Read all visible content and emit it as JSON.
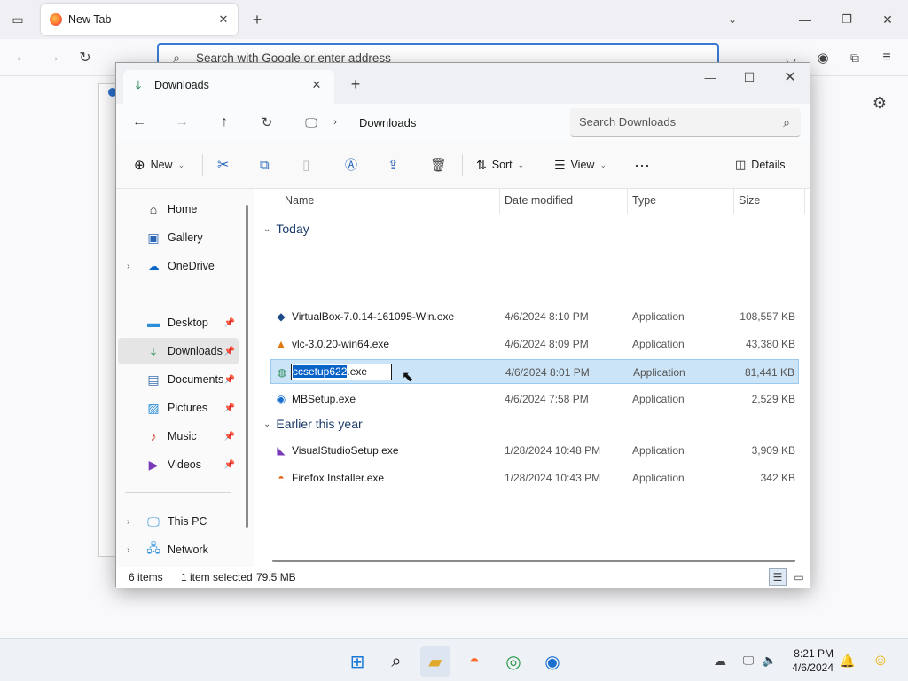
{
  "browser": {
    "tab_title": "New Tab",
    "url_placeholder": "Search with Google or enter address"
  },
  "explorer": {
    "tab_title": "Downloads",
    "breadcrumb": "Downloads",
    "search_placeholder": "Search Downloads",
    "commands": {
      "new": "New",
      "sort": "Sort",
      "view": "View",
      "details": "Details"
    },
    "nav": {
      "home": "Home",
      "gallery": "Gallery",
      "onedrive": "OneDrive",
      "desktop": "Desktop",
      "downloads": "Downloads",
      "documents": "Documents",
      "pictures": "Pictures",
      "music": "Music",
      "videos": "Videos",
      "thispc": "This PC",
      "network": "Network"
    },
    "columns": {
      "name": "Name",
      "date": "Date modified",
      "type": "Type",
      "size": "Size"
    },
    "groups": {
      "today": "Today",
      "earlier": "Earlier this year"
    },
    "files": [
      {
        "name": "VirtualBox-7.0.14-161095-Win.exe",
        "date": "4/6/2024 8:10 PM",
        "type": "Application",
        "size": "108,557 KB"
      },
      {
        "name": "vlc-3.0.20-win64.exe",
        "date": "4/6/2024 8:09 PM",
        "type": "Application",
        "size": "43,380 KB"
      },
      {
        "name": "ccsetup622.exe",
        "date": "4/6/2024 8:01 PM",
        "type": "Application",
        "size": "81,441 KB"
      },
      {
        "name": "MBSetup.exe",
        "date": "4/6/2024 7:58 PM",
        "type": "Application",
        "size": "2,529 KB"
      },
      {
        "name": "VisualStudioSetup.exe",
        "date": "1/28/2024 10:48 PM",
        "type": "Application",
        "size": "3,909 KB"
      },
      {
        "name": "Firefox Installer.exe",
        "date": "1/28/2024 10:43 PM",
        "type": "Application",
        "size": "342 KB"
      }
    ],
    "rename": {
      "selected": "ccsetup622",
      "ext": ".exe"
    },
    "status": {
      "items": "6 items",
      "selected": "1 item selected",
      "size": "79.5 MB"
    }
  },
  "taskbar": {
    "time": "8:21 PM",
    "date": "4/6/2024"
  }
}
